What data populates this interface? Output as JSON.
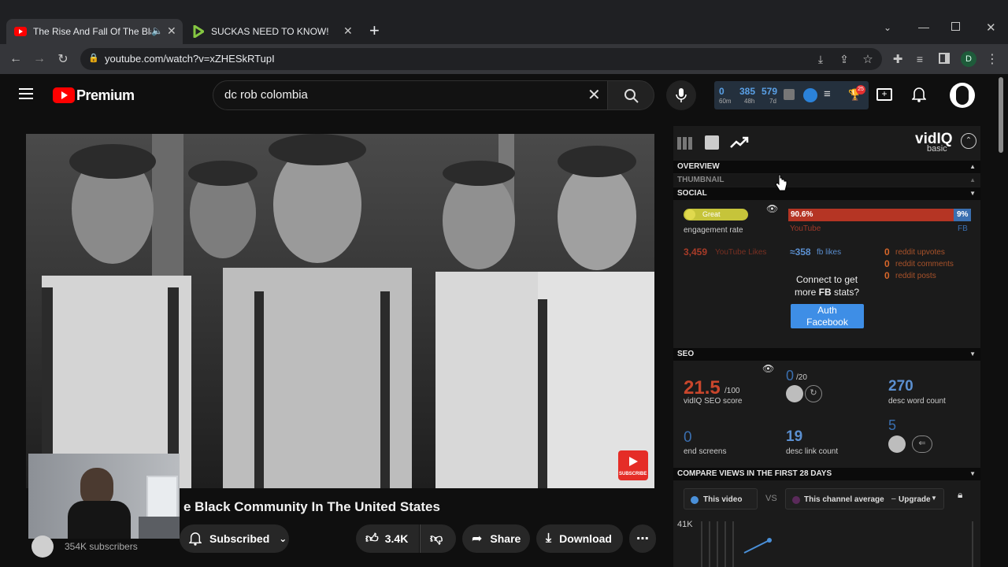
{
  "browser": {
    "tabs": [
      {
        "title": "The Rise And Fall Of The Blac",
        "active": true
      },
      {
        "title": "SUCKAS NEED TO KNOW!",
        "active": false
      }
    ],
    "new_tab": "+",
    "url": "youtube.com/watch?v=xZHESkRTupI",
    "profile_initial": "D"
  },
  "youtube": {
    "logo_text": "Premium",
    "search_value": "dc rob colombia",
    "vidiq_counters": {
      "c1_value": "0",
      "c1_label": "60m",
      "c2_value": "385",
      "c2_label": "48h",
      "c3_value": "579",
      "c3_label": "7d"
    },
    "notification_badge": "25"
  },
  "video": {
    "title": "e Black Community In The United States",
    "watermark": "SUBSCRIBE",
    "subscribers": "354K subscribers",
    "subscribe_label": "Subscribed",
    "likes": "3.4K",
    "share_label": "Share",
    "download_label": "Download"
  },
  "vidiq": {
    "brand": "vidIQ",
    "plan": "basic",
    "sections": {
      "overview": "OVERVIEW",
      "thumbnail": "THUMBNAIL",
      "social": "SOCIAL",
      "seo": "SEO",
      "compare": "COMPARE VIEWS IN THE FIRST 28 DAYS"
    },
    "social": {
      "engagement_badge": "Great",
      "engagement_label": "engagement rate",
      "yt_percent": "90.6%",
      "fb_percent": "9%",
      "yt_percent_value": 90.6,
      "yt_bar_label": "YouTube",
      "fb_bar_label": "FB",
      "yt_likes_value": "3,459",
      "yt_likes_label": "YouTube Likes",
      "fb_likes_value": "≈358",
      "fb_likes_label": "fb likes",
      "reddit": [
        {
          "value": "0",
          "label": "reddit upvotes"
        },
        {
          "value": "0",
          "label": "reddit comments"
        },
        {
          "value": "0",
          "label": "reddit posts"
        }
      ],
      "connect_text_1": "Connect to get",
      "connect_text_2a": "more ",
      "connect_text_2b": "FB",
      "connect_text_2c": " stats?",
      "auth_button_1": "Auth",
      "auth_button_2": "Facebook"
    },
    "seo": {
      "score": "21.5",
      "score_max": "/100",
      "score_label": "vidIQ SEO score",
      "tags_value": "0",
      "tags_max": "/20",
      "desc_words_value": "270",
      "desc_words_label": "desc word count",
      "end_screens_value": "0",
      "end_screens_label": "end screens",
      "desc_links_value": "19",
      "desc_links_label": "desc link count",
      "cards_value": "5"
    },
    "compare": {
      "this_video": "This video",
      "vs": "VS",
      "channel_avg": "This channel average",
      "upgrade": "Upgrade",
      "y_tick": "41K"
    }
  }
}
